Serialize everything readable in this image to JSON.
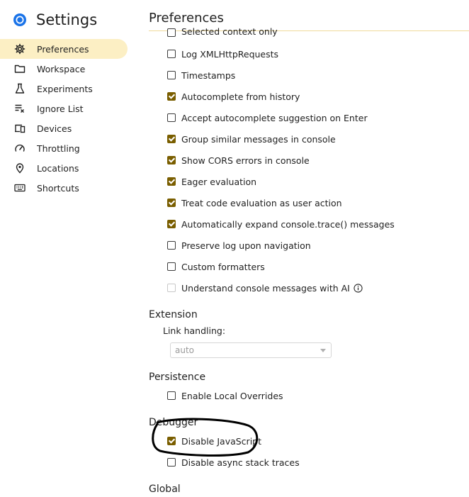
{
  "app": {
    "title": "Settings"
  },
  "sidebar": {
    "items": [
      {
        "label": "Preferences",
        "icon": "gear-icon",
        "active": true
      },
      {
        "label": "Workspace",
        "icon": "folder-icon"
      },
      {
        "label": "Experiments",
        "icon": "flask-icon"
      },
      {
        "label": "Ignore List",
        "icon": "ignore-list-icon"
      },
      {
        "label": "Devices",
        "icon": "devices-icon"
      },
      {
        "label": "Throttling",
        "icon": "gauge-icon"
      },
      {
        "label": "Locations",
        "icon": "location-pin-icon"
      },
      {
        "label": "Shortcuts",
        "icon": "keyboard-icon"
      }
    ]
  },
  "main": {
    "title": "Preferences",
    "console_options": [
      {
        "label": "Selected context only",
        "checked": false
      },
      {
        "label": "Log XMLHttpRequests",
        "checked": false
      },
      {
        "label": "Timestamps",
        "checked": false
      },
      {
        "label": "Autocomplete from history",
        "checked": true
      },
      {
        "label": "Accept autocomplete suggestion on Enter",
        "checked": false
      },
      {
        "label": "Group similar messages in console",
        "checked": true
      },
      {
        "label": "Show CORS errors in console",
        "checked": true
      },
      {
        "label": "Eager evaluation",
        "checked": true
      },
      {
        "label": "Treat code evaluation as user action",
        "checked": true
      },
      {
        "label": "Automatically expand console.trace() messages",
        "checked": true
      },
      {
        "label": "Preserve log upon navigation",
        "checked": false
      },
      {
        "label": "Custom formatters",
        "checked": false
      },
      {
        "label": "Understand console messages with AI",
        "checked": false,
        "disabled": true
      }
    ],
    "extension": {
      "title": "Extension",
      "link_handling_label": "Link handling:",
      "link_handling_value": "auto"
    },
    "persistence": {
      "title": "Persistence",
      "options": [
        {
          "label": "Enable Local Overrides",
          "checked": false
        }
      ]
    },
    "debugger": {
      "title": "Debugger",
      "options": [
        {
          "label": "Disable JavaScript",
          "checked": true
        },
        {
          "label": "Disable async stack traces",
          "checked": false
        }
      ]
    },
    "global": {
      "title": "Global"
    }
  },
  "colors": {
    "accent": "#7a5e00",
    "active_nav_bg": "#fcefc4",
    "title_rule": "#f0d99a",
    "annotation_stroke": "#000000"
  }
}
